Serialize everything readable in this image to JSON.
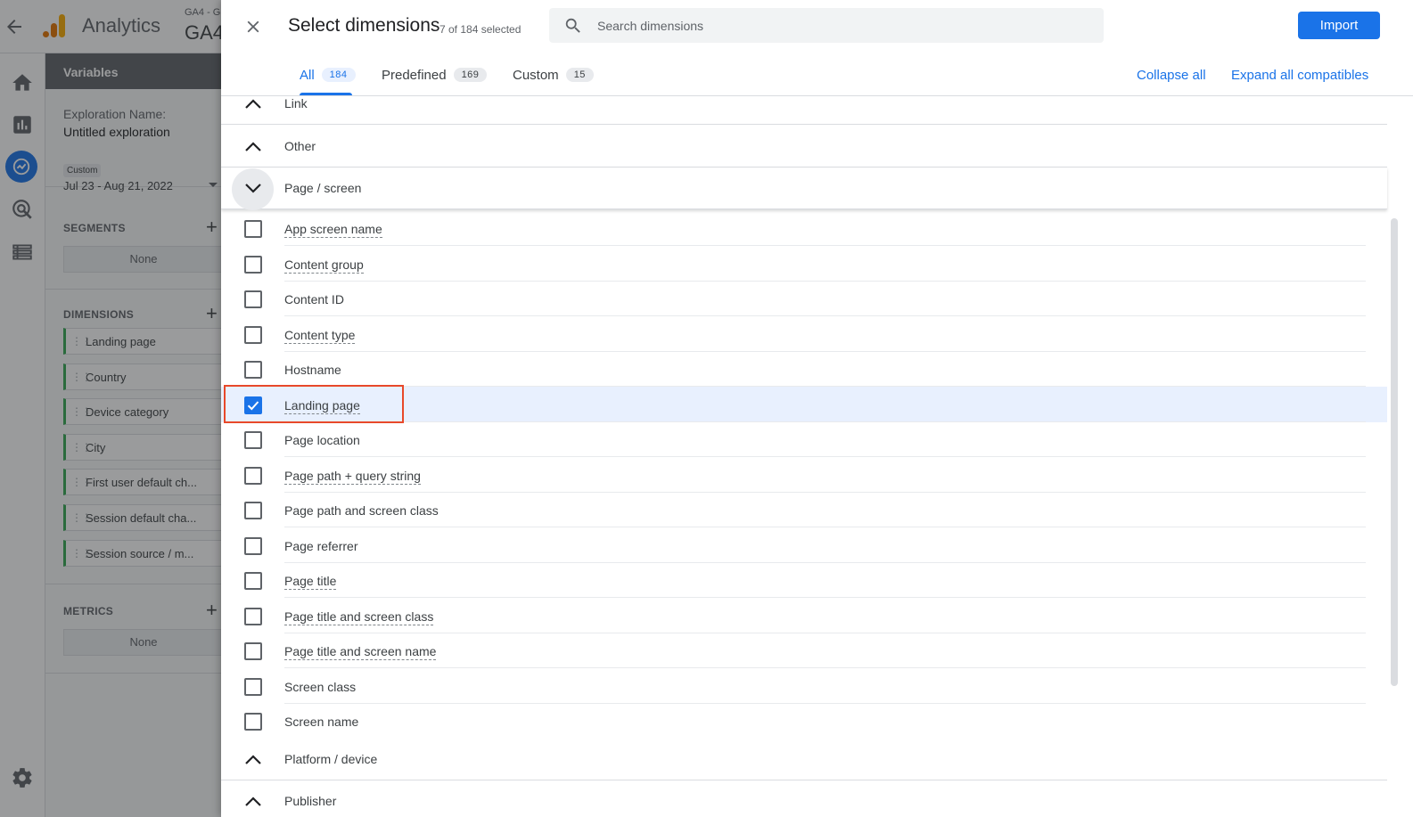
{
  "app": {
    "product_name": "Analytics",
    "account_small": "GA4 - G",
    "account_big": "GA4",
    "nav_icons": [
      "home-icon",
      "reports-icon",
      "explore-icon",
      "advertising-icon",
      "configure-icon"
    ],
    "settings_icon": "gear-icon"
  },
  "variables": {
    "heading": "Variables",
    "exploration_label": "Exploration Name:",
    "exploration_value": "Untitled exploration",
    "date_pill": "Custom",
    "date_range": "Jul 23 - Aug 21, 2022",
    "segments_title": "SEGMENTS",
    "segments_none": "None",
    "dimensions_title": "DIMENSIONS",
    "dimensions": [
      "Landing page",
      "Country",
      "Device category",
      "City",
      "First user default ch...",
      "Session default cha...",
      "Session source / m..."
    ],
    "metrics_title": "METRICS",
    "metrics_none": "None"
  },
  "dialog": {
    "title": "Select dimensions",
    "selected_count": "7 of 184 selected",
    "search_placeholder": "Search dimensions",
    "import_label": "Import",
    "tabs": [
      {
        "label": "All",
        "count": "184",
        "active": true
      },
      {
        "label": "Predefined",
        "count": "169",
        "active": false
      },
      {
        "label": "Custom",
        "count": "15",
        "active": false
      }
    ],
    "collapse_all": "Collapse all",
    "expand_all": "Expand all compatibles",
    "groups_before": [
      "Link",
      "Other"
    ],
    "expanded_group": "Page / screen",
    "items": [
      {
        "label": "App screen name",
        "checked": false
      },
      {
        "label": "Content group",
        "checked": false
      },
      {
        "label": "Content ID",
        "checked": false
      },
      {
        "label": "Content type",
        "checked": false
      },
      {
        "label": "Hostname",
        "checked": false
      },
      {
        "label": "Landing page",
        "checked": true
      },
      {
        "label": "Page location",
        "checked": false
      },
      {
        "label": "Page path + query string",
        "checked": false
      },
      {
        "label": "Page path and screen class",
        "checked": false
      },
      {
        "label": "Page referrer",
        "checked": false
      },
      {
        "label": "Page title",
        "checked": false
      },
      {
        "label": "Page title and screen class",
        "checked": false
      },
      {
        "label": "Page title and screen name",
        "checked": false
      },
      {
        "label": "Screen class",
        "checked": false
      },
      {
        "label": "Screen name",
        "checked": false
      }
    ],
    "groups_after": [
      "Platform / device",
      "Publisher"
    ]
  },
  "colors": {
    "accent": "#1a73e8",
    "highlight": "#e8492a",
    "dimension_chip": "#34a853",
    "logo_orange": "#f9ab00",
    "logo_dark_orange": "#e37400"
  }
}
